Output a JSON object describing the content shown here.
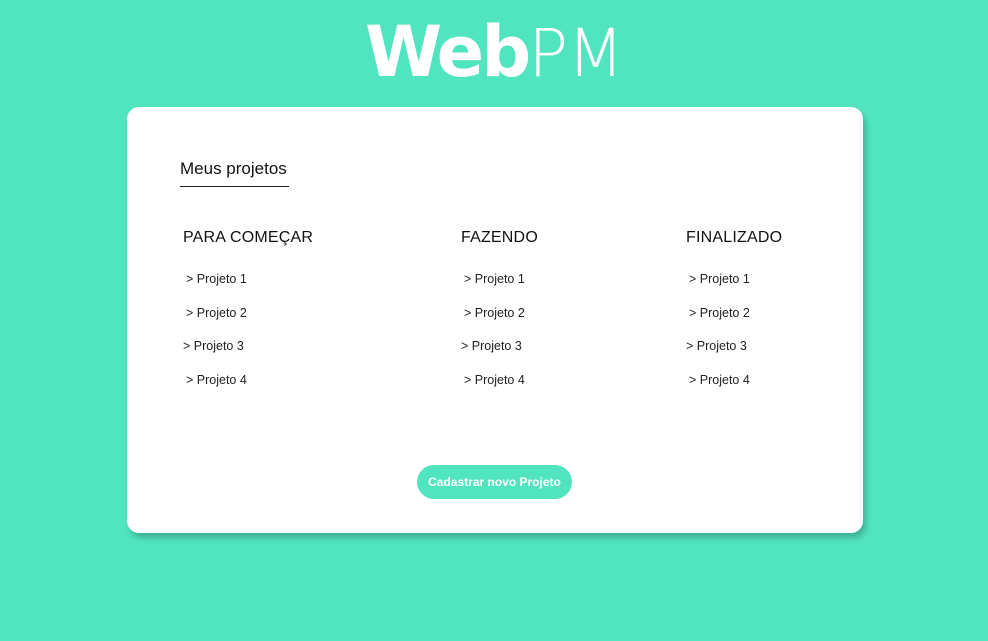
{
  "logo": {
    "bold": "Web",
    "light": "PM"
  },
  "section": {
    "title": "Meus projetos"
  },
  "columns": [
    {
      "title": "PARA COMEÇAR",
      "items": [
        "> Projeto 1",
        "> Projeto 2",
        "> Projeto 3",
        "> Projeto 4"
      ]
    },
    {
      "title": "FAZENDO",
      "items": [
        "> Projeto 1",
        "> Projeto 2",
        "> Projeto 3",
        "> Projeto 4"
      ]
    },
    {
      "title": "FINALIZADO",
      "items": [
        "> Projeto 1",
        "> Projeto 2",
        "> Projeto 3",
        "> Projeto 4"
      ]
    }
  ],
  "cta": {
    "label": "Cadastrar novo Projeto"
  },
  "colors": {
    "background": "#50e5bf",
    "card": "#ffffff",
    "accent": "#50e5bf",
    "text": "#111111"
  }
}
